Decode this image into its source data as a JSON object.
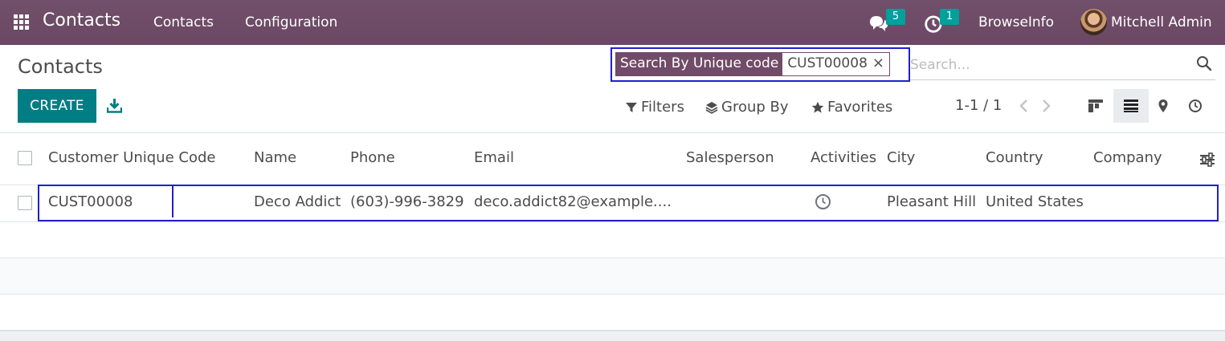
{
  "navbar": {
    "app_title": "Contacts",
    "menu": [
      "Contacts",
      "Configuration"
    ],
    "messages_count": "5",
    "activities_count": "1",
    "company": "BrowseInfo",
    "user": "Mitchell Admin",
    "bg_color": "#714b67"
  },
  "control_panel": {
    "title": "Contacts",
    "facet_label": "Search By Unique code",
    "facet_value": "CUST00008",
    "facet_close": "×",
    "search_placeholder": "Search...",
    "create_label": "CREATE",
    "filters_label": "Filters",
    "groupby_label": "Group By",
    "favorites_label": "Favorites",
    "pager": "1-1 / 1",
    "views": [
      "kanban-icon",
      "list-icon",
      "map-icon",
      "activity-icon"
    ],
    "active_view": "list"
  },
  "table": {
    "columns": [
      "Customer Unique Code",
      "Name",
      "Phone",
      "Email",
      "Salesperson",
      "Activities",
      "City",
      "Country",
      "Company"
    ],
    "rows": [
      {
        "code": "CUST00008",
        "name": "Deco Addict",
        "phone": "(603)-996-3829",
        "email": "deco.addict82@example....",
        "salesperson": "",
        "activities_icon": "clock-icon",
        "city": "Pleasant Hill",
        "country": "United States",
        "company": ""
      }
    ]
  },
  "accent_color": "#017e84",
  "highlight_color": "#1f1fcf"
}
